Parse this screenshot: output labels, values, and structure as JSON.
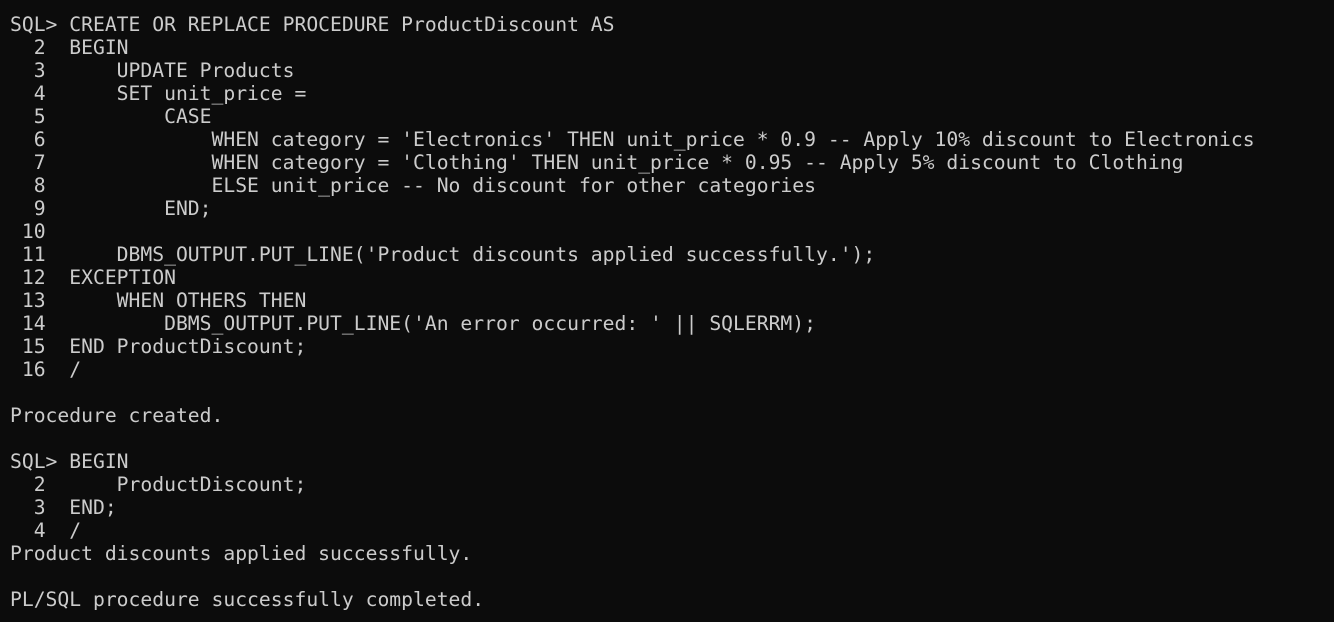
{
  "terminal": {
    "lines": [
      "SQL> CREATE OR REPLACE PROCEDURE ProductDiscount AS",
      "  2  BEGIN",
      "  3      UPDATE Products",
      "  4      SET unit_price =",
      "  5          CASE",
      "  6              WHEN category = 'Electronics' THEN unit_price * 0.9 -- Apply 10% discount to Electronics",
      "  7              WHEN category = 'Clothing' THEN unit_price * 0.95 -- Apply 5% discount to Clothing",
      "  8              ELSE unit_price -- No discount for other categories",
      "  9          END;",
      " 10",
      " 11      DBMS_OUTPUT.PUT_LINE('Product discounts applied successfully.');",
      " 12  EXCEPTION",
      " 13      WHEN OTHERS THEN",
      " 14          DBMS_OUTPUT.PUT_LINE('An error occurred: ' || SQLERRM);",
      " 15  END ProductDiscount;",
      " 16  /",
      "",
      "Procedure created.",
      "",
      "SQL> BEGIN",
      "  2      ProductDiscount;",
      "  3  END;",
      "  4  /",
      "Product discounts applied successfully.",
      "",
      "PL/SQL procedure successfully completed."
    ]
  }
}
